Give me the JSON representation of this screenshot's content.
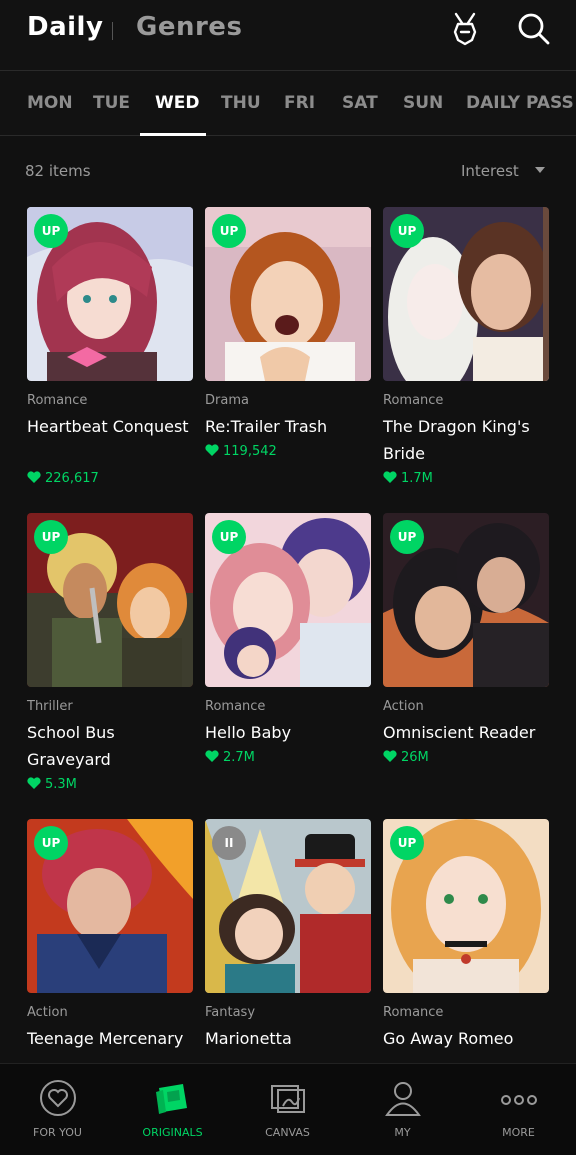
{
  "header": {
    "title_daily": "Daily",
    "title_genres": "Genres",
    "icons": [
      "bunny-badge-icon",
      "search-icon"
    ]
  },
  "tabs": [
    {
      "label": "MON",
      "active": false
    },
    {
      "label": "TUE",
      "active": false
    },
    {
      "label": "WED",
      "active": true
    },
    {
      "label": "THU",
      "active": false
    },
    {
      "label": "FRI",
      "active": false
    },
    {
      "label": "SAT",
      "active": false
    },
    {
      "label": "SUN",
      "active": false
    },
    {
      "label": "DAILY PASS",
      "active": false
    }
  ],
  "toolbar": {
    "count": "82 items",
    "sort_label": "Interest"
  },
  "cards": [
    {
      "badge": "UP",
      "genre": "Romance",
      "title": "Heartbeat Conquest",
      "likes": "226,617"
    },
    {
      "badge": "UP",
      "genre": "Drama",
      "title": "Re:Trailer Trash",
      "likes": "119,542"
    },
    {
      "badge": "UP",
      "genre": "Romance",
      "title": "The Dragon King's Bride",
      "likes": "1.7M"
    },
    {
      "badge": "UP",
      "genre": "Thriller",
      "title": "School Bus Graveyard",
      "likes": "5.3M"
    },
    {
      "badge": "UP",
      "genre": "Romance",
      "title": "Hello Baby",
      "likes": "2.7M"
    },
    {
      "badge": "UP",
      "genre": "Action",
      "title": "Omniscient Reader",
      "likes": "26M"
    },
    {
      "badge": "UP",
      "genre": "Action",
      "title": "Teenage Mercenary",
      "likes": ""
    },
    {
      "badge": "II",
      "genre": "Fantasy",
      "title": "Marionetta",
      "likes": ""
    },
    {
      "badge": "UP",
      "genre": "Romance",
      "title": "Go Away Romeo",
      "likes": ""
    }
  ],
  "bottom_nav": [
    {
      "label": "FOR YOU",
      "icon": "heart-circle-icon",
      "active": false
    },
    {
      "label": "ORIGINALS",
      "icon": "originals-icon",
      "active": true
    },
    {
      "label": "CANVAS",
      "icon": "canvas-icon",
      "active": false
    },
    {
      "label": "MY",
      "icon": "person-icon",
      "active": false
    },
    {
      "label": "MORE",
      "icon": "more-dots-icon",
      "active": false
    }
  ],
  "colors": {
    "accent": "#00d564",
    "background": "#111111",
    "muted_text": "#9a9a9a"
  }
}
